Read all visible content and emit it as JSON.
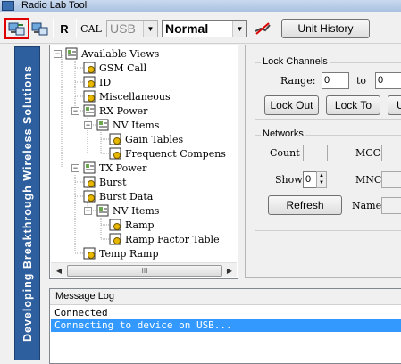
{
  "window": {
    "title": "Radio Lab Tool"
  },
  "toolbar": {
    "r_label": "R",
    "cal_label": "CAL",
    "interface_value": "USB",
    "mode_value": "Normal",
    "unit_history_label": "Unit History"
  },
  "banner": {
    "text": "Developing Breakthrough Wireless Solutions"
  },
  "tree": {
    "nodes": [
      {
        "label": "Available Views"
      },
      {
        "label": "GSM Call"
      },
      {
        "label": "ID"
      },
      {
        "label": "Miscellaneous"
      },
      {
        "label": "RX Power"
      },
      {
        "label": "NV Items"
      },
      {
        "label": "Gain Tables"
      },
      {
        "label": "Frequenct Compens"
      },
      {
        "label": "TX Power"
      },
      {
        "label": "Burst"
      },
      {
        "label": "Burst Data"
      },
      {
        "label": "NV Items"
      },
      {
        "label": "Ramp"
      },
      {
        "label": "Ramp Factor Table"
      },
      {
        "label": "Temp Ramp"
      }
    ],
    "scroll_thumb": "III"
  },
  "lock_channels": {
    "title": "Lock Channels",
    "range_label": "Range:",
    "from_value": "0",
    "to_label": "to",
    "to_value": "0",
    "lock_out_label": "Lock Out",
    "lock_to_label": "Lock To",
    "extra_label": "U"
  },
  "networks": {
    "title": "Networks",
    "count_label": "Count",
    "mcc_label": "MCC",
    "show_label": "Show",
    "show_value": "0",
    "mnc_label": "MNC",
    "refresh_label": "Refresh",
    "name_label": "Name"
  },
  "message_log": {
    "title": "Message Log",
    "lines": [
      "Connected",
      "Connecting to device on USB..."
    ]
  },
  "colors": {
    "banner": "#2d5f9e",
    "selection": "#3399ff",
    "highlight_outline": "#e00000"
  }
}
